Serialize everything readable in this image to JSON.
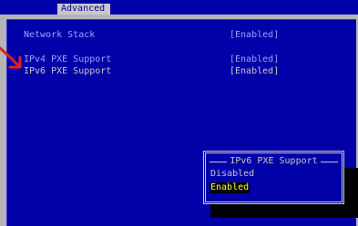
{
  "header": {
    "tab_label": "Advanced"
  },
  "settings": [
    {
      "label": "Network Stack",
      "value": "[Enabled]"
    },
    {
      "label": "IPv4 PXE Support",
      "value": "[Enabled]"
    },
    {
      "label": "IPv6 PXE Support",
      "value": "[Enabled]"
    }
  ],
  "popup": {
    "title": "IPv6 PXE Support",
    "options": [
      "Disabled",
      "Enabled"
    ],
    "selected": "Enabled"
  },
  "colors": {
    "background_blue": "#0000a8",
    "text_light_blue": "#9aa4ff",
    "text_gray": "#c8c8c8",
    "highlight_yellow": "#ffff55",
    "annotation_red": "#e02020"
  },
  "annotation": {
    "icon": "red-arrow-icon"
  }
}
